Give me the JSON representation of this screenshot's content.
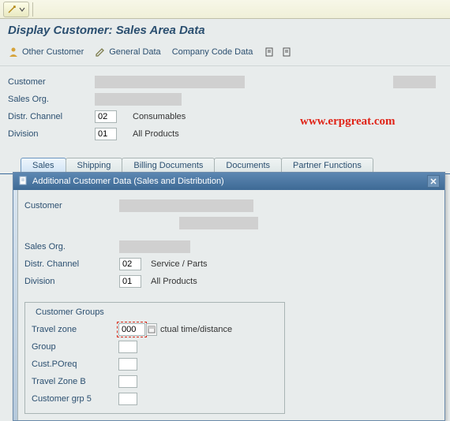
{
  "top_strip": {
    "dropdown_icon": "dropdown-indicator"
  },
  "header": {
    "title": "Display Customer: Sales Area Data"
  },
  "action_bar": {
    "other_customer": "Other Customer",
    "general_data": "General Data",
    "company_code_data": "Company Code Data"
  },
  "form": {
    "customer_label": "Customer",
    "sales_org_label": "Sales Org.",
    "distr_channel_label": "Distr. Channel",
    "distr_channel_value": "02",
    "distr_channel_desc": "Consumables",
    "division_label": "Division",
    "division_value": "01",
    "division_desc": "All Products"
  },
  "watermark": "www.erpgreat.com",
  "tabs": {
    "sales": "Sales",
    "shipping": "Shipping",
    "billing": "Billing Documents",
    "documents": "Documents",
    "partner": "Partner Functions"
  },
  "popup": {
    "title": "Additional Customer Data (Sales and Distribution)",
    "customer_label": "Customer",
    "sales_org_label": "Sales Org.",
    "distr_channel_label": "Distr. Channel",
    "distr_channel_value": "02",
    "distr_channel_desc": "Service / Parts",
    "division_label": "Division",
    "division_value": "01",
    "division_desc": "All Products",
    "groupbox_title": "Customer Groups",
    "rows": {
      "travel_zone_label": "Travel zone",
      "travel_zone_value": "000",
      "travel_zone_desc": "ctual time/distance",
      "group_label": "Group",
      "cust_poreq_label": "Cust.POreq",
      "travel_zone_b_label": "Travel Zone B",
      "customer_grp5_label": "Customer grp 5"
    }
  }
}
